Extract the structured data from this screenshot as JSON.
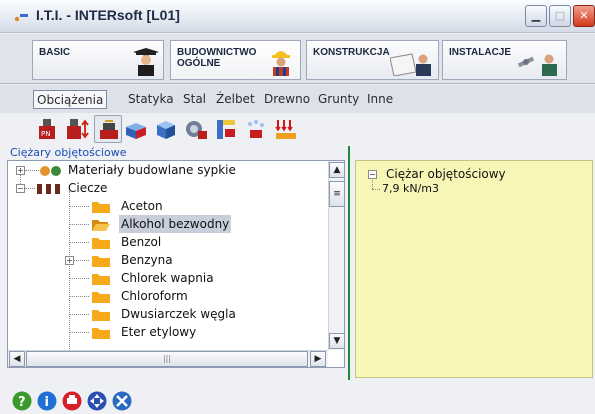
{
  "window": {
    "title": "I.T.I. - INTERsoft [L01]"
  },
  "categories": [
    {
      "label": "BASIC",
      "icon": "graduate-icon"
    },
    {
      "label": "BUDOWNICTWO OGÓLNE",
      "line1": "BUDOWNICTWO",
      "line2": "OGÓLNE",
      "icon": "builder-icon"
    },
    {
      "label": "KONSTRUKCJA",
      "icon": "engineer-drawing-icon"
    },
    {
      "label": "INSTALACJE",
      "icon": "plumber-icon"
    }
  ],
  "submenu": [
    "Obciążenia",
    "Statyka",
    "Stal",
    "Żelbet",
    "Drewno",
    "Grunty",
    "Inne"
  ],
  "submenu_selected": "Obciążenia",
  "toolbar_icons": [
    "pn-weight-icon",
    "pn-weight-arrow-icon",
    "pn-scale-icon",
    "pn-box-icon",
    "pn-cube-icon",
    "pn-wheel-icon",
    "pn-wall-icon",
    "pn-snow-icon",
    "pn-wind-icon"
  ],
  "left_panel": {
    "caption": "Ciężary objętościowe",
    "tree": [
      {
        "label": "Materiały budowlane sypkie",
        "level": 0,
        "expander": "+"
      },
      {
        "label": "Ciecze",
        "level": 0,
        "expander": "-"
      },
      {
        "label": "Aceton",
        "level": 1
      },
      {
        "label": "Alkohol bezwodny",
        "level": 1,
        "selected": true
      },
      {
        "label": "Benzol",
        "level": 1
      },
      {
        "label": "Benzyna",
        "level": 1,
        "expander": "+"
      },
      {
        "label": "Chlorek wapnia",
        "level": 1
      },
      {
        "label": "Chloroform",
        "level": 1
      },
      {
        "label": "Dwusiarczek węgla",
        "level": 1
      },
      {
        "label": "Eter etylowy",
        "level": 1
      }
    ]
  },
  "right_panel": {
    "root_label": "Ciężar objętościowy",
    "value": "7,9 kN/m3"
  },
  "bottom_icons": [
    "help-icon",
    "info-icon",
    "print-icon",
    "navigate-icon",
    "settings-tools-icon"
  ],
  "colors": {
    "accent_green": "#1e8a3a",
    "right_panel_bg": "#f8f6b6",
    "selection": "#c9cedb",
    "caption_blue": "#1b49b5"
  }
}
